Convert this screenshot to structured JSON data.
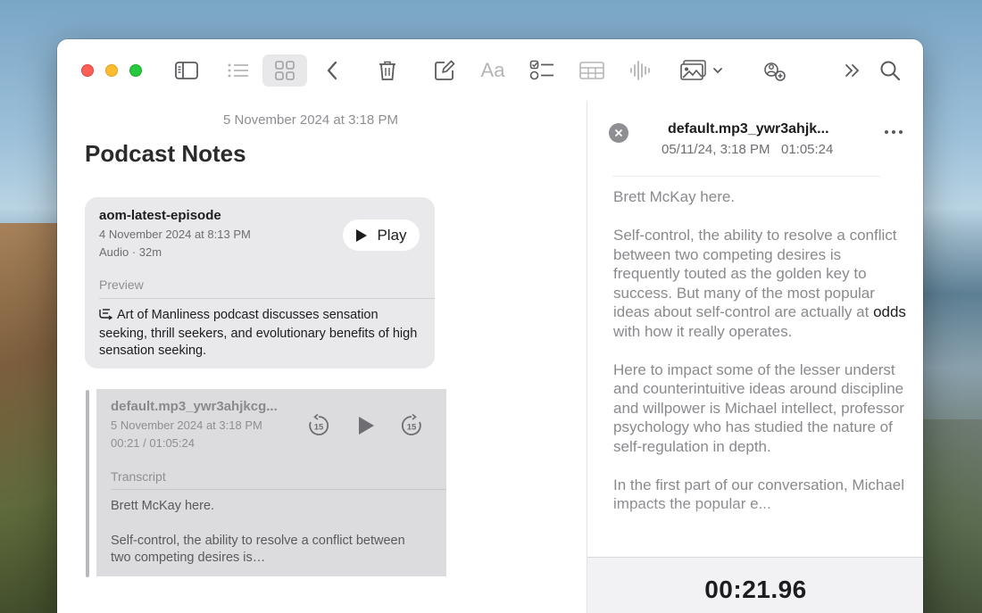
{
  "toolbar": {
    "font_button_label": "Aa"
  },
  "note": {
    "date": "5 November 2024 at 3:18 PM",
    "title": "Podcast Notes"
  },
  "attachment_card": {
    "title": "aom-latest-episode",
    "date": "4 November 2024 at 8:13 PM",
    "meta": "Audio · 32m",
    "play_label": "Play",
    "preview_label": "Preview",
    "summary": "Art of Manliness podcast discusses sensation seeking, thrill seekers, and evolutionary benefits of high sensation seeking."
  },
  "recording_card": {
    "title": "default.mp3_ywr3ahjkcg...",
    "date": "5 November 2024 at 3:18 PM",
    "time": "00:21 / 01:05:24",
    "skip_back_label": "15",
    "skip_forward_label": "15",
    "transcript_label": "Transcript",
    "transcript_line1": "Brett McKay here.",
    "transcript_line2": "Self-control, the ability to resolve a conflict between two competing desires is…"
  },
  "transcript_panel": {
    "title": "default.mp3_ywr3ahjk...",
    "subtitle": "05/11/24, 3:18 PM   01:05:24",
    "paragraph1": "Brett McKay here.",
    "paragraph2_before": "Self-control, the ability to resolve a conflict between two competing desires is frequently touted as the golden key to success. But many of the most popular ideas about self-control are actually at ",
    "paragraph2_highlight": "odds",
    "paragraph2_after": " with how it really operates.",
    "paragraph3": "Here to impact some of the lesser underst and counterintuitive ideas around discipline and willpower is Michael intellect, professor psychology who has studied the nature of self-regulation in depth.",
    "paragraph4": "In the first part of our conversation, Michael impacts the popular e...",
    "timer": "00:21.96"
  },
  "colors": {
    "close": "#ff5f57",
    "minimize": "#febc2e",
    "maximize": "#28c840"
  }
}
